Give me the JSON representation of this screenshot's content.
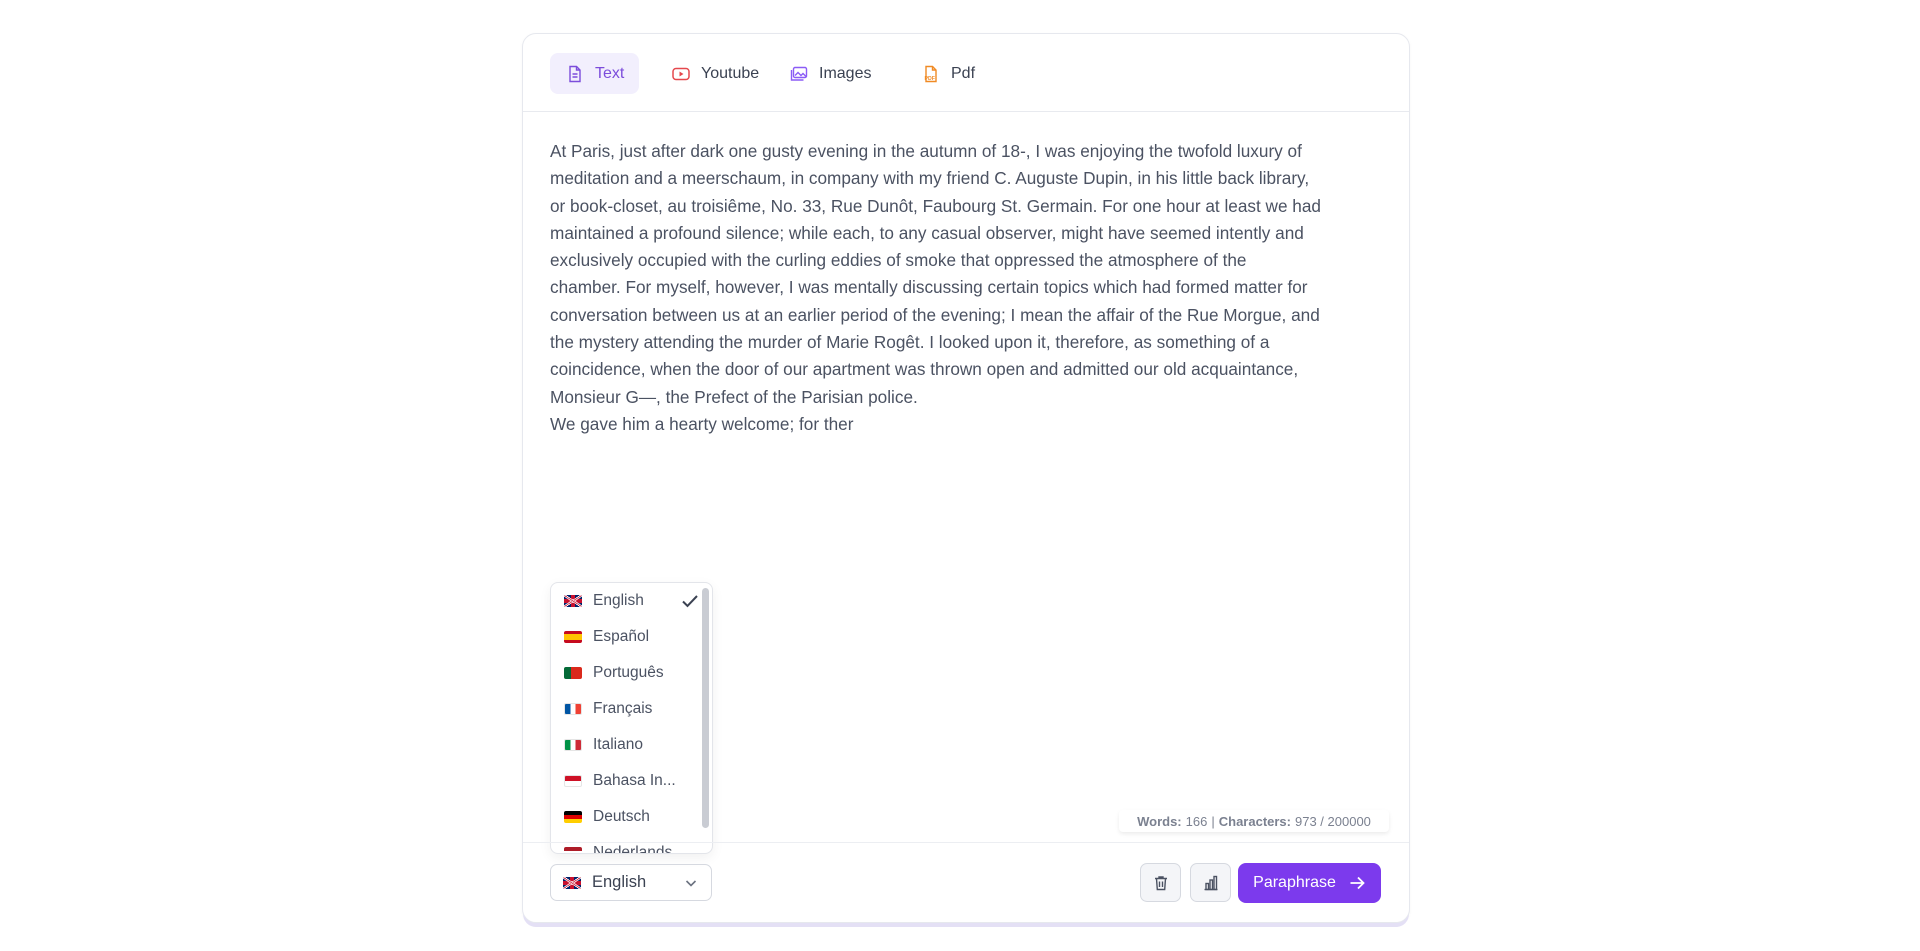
{
  "tabs": [
    {
      "label": "Text",
      "icon": "document-icon",
      "active": true
    },
    {
      "label": "Youtube",
      "icon": "youtube-icon",
      "active": false
    },
    {
      "label": "Images",
      "icon": "images-icon",
      "active": false
    },
    {
      "label": "Pdf",
      "icon": "pdf-icon",
      "active": false
    }
  ],
  "editor": {
    "text": "At Paris, just after dark one gusty evening in the autumn of 18-, I was enjoying the twofold luxury of\nmeditation and a meerschaum, in company with my friend C. Auguste Dupin, in his little back library,\nor book-closet, au troisiême, No. 33, Rue Dunôt, Faubourg St. Germain. For one hour at least we had\nmaintained a profound silence; while each, to any casual observer, might have seemed intently and\nexclusively occupied with the curling eddies of smoke that oppressed the atmosphere of the\nchamber. For myself, however, I was mentally discussing certain topics which had formed matter for\nconversation between us at an earlier period of the evening; I mean the affair of the Rue Morgue, and\nthe mystery attending the murder of Marie Rogêt. I looked upon it, therefore, as something of a\ncoincidence, when the door of our apartment was thrown open and admitted our old acquaintance,\nMonsieur G—, the Prefect of the Parisian police.\nWe gave him a hearty welcome; for ther"
  },
  "language_dropdown": {
    "items": [
      {
        "label": "English",
        "flag": "uk-flag-icon",
        "selected": true
      },
      {
        "label": "Español",
        "flag": "spain-flag-icon",
        "selected": false
      },
      {
        "label": "Português",
        "flag": "portugal-flag-icon",
        "selected": false
      },
      {
        "label": "Français",
        "flag": "france-flag-icon",
        "selected": false
      },
      {
        "label": "Italiano",
        "flag": "italy-flag-icon",
        "selected": false
      },
      {
        "label": "Bahasa In...",
        "flag": "indonesia-flag-icon",
        "selected": false
      },
      {
        "label": "Deutsch",
        "flag": "germany-flag-icon",
        "selected": false
      },
      {
        "label": "Nederlands",
        "flag": "netherlands-flag-icon",
        "selected": false
      }
    ]
  },
  "counter": {
    "words_label": "Words:",
    "words_value": "166",
    "separator": "|",
    "chars_label": "Characters:",
    "chars_value": "973 / 200000"
  },
  "footer": {
    "selected_language": "English",
    "delete_icon": "trash-icon",
    "stats_icon": "bar-chart-icon",
    "primary_label": "Paraphrase"
  },
  "colors": {
    "accent": "#7c3aed",
    "active_tab_bg": "#f2effd",
    "active_tab_text": "#7c4ddb"
  }
}
